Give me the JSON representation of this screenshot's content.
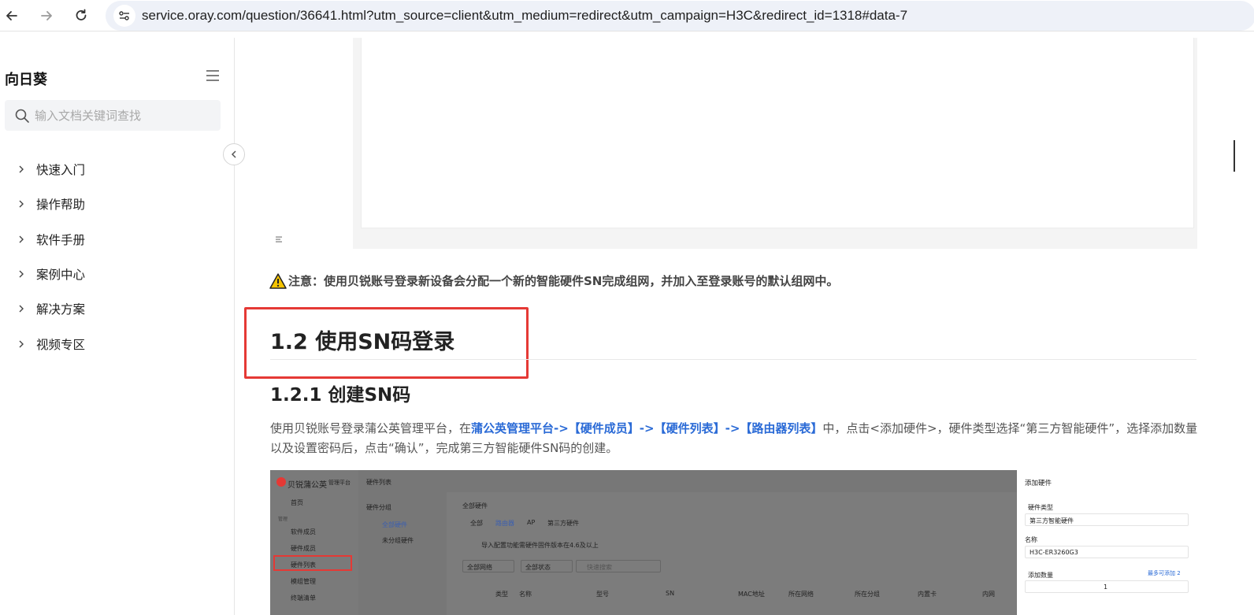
{
  "browser": {
    "url": "service.oray.com/question/36641.html?utm_source=client&utm_medium=redirect&utm_campaign=H3C&redirect_id=1318#data-7"
  },
  "sidebar": {
    "brand": "向日葵",
    "search_placeholder": "输入文档关键词查找",
    "items": [
      {
        "label": "快速入门"
      },
      {
        "label": "操作帮助"
      },
      {
        "label": "软件手册"
      },
      {
        "label": "案例中心"
      },
      {
        "label": "解决方案"
      },
      {
        "label": "视频专区"
      }
    ]
  },
  "content": {
    "note": "注意：使用贝锐账号登录新设备会分配一个新的智能硬件SN完成组网，并加入至登录账号的默认组网中。",
    "heading_12": "1.2 使用SN码登录",
    "heading_121": "1.2.1 创建SN码",
    "para_prefix": "使用贝锐账号登录蒲公英管理平台，在",
    "para_link": "蒲公英管理平台->【硬件成员】->【硬件列表】->【路由器列表】",
    "para_suffix": "中，点击<添加硬件>，硬件类型选择“第三方智能硬件”，选择添加数量以及设置密码后，点击“确认”，完成第三方智能硬件SN码的创建。"
  },
  "embedded_screenshot": {
    "logo_text": "贝锐蒲公英",
    "platform_text": "管理平台",
    "menu": [
      "首页",
      "管理",
      "软件成员",
      "硬件成员",
      "硬件列表",
      "模组管理",
      "终端清单"
    ],
    "page_title": "硬件列表",
    "group_title": "硬件分组",
    "groups": [
      "全部硬件",
      "未分组硬件"
    ],
    "list_title": "全部硬件",
    "tabs": [
      "全部",
      "路由器",
      "AP",
      "第三方硬件"
    ],
    "tip": "导入配置功能需硬件固件版本在4.6及以上",
    "filters": [
      "全部网络",
      "全部状态",
      "快速搜索"
    ],
    "columns": [
      "类型",
      "名称",
      "型号",
      "SN",
      "MAC地址",
      "所在网络",
      "所在分组",
      "内置卡",
      "内网"
    ],
    "drawer": {
      "title": "添加硬件",
      "type_label": "硬件类型",
      "type_value": "第三方智能硬件",
      "name_label": "名称",
      "name_value": "H3C-ER3260G3",
      "qty_label": "添加数量",
      "qty_hint": "最多可添加 2",
      "qty_value": "1"
    }
  },
  "colors": {
    "link": "#2a6ad6",
    "highlight_box": "#e53935",
    "warning": "#f5c400"
  }
}
